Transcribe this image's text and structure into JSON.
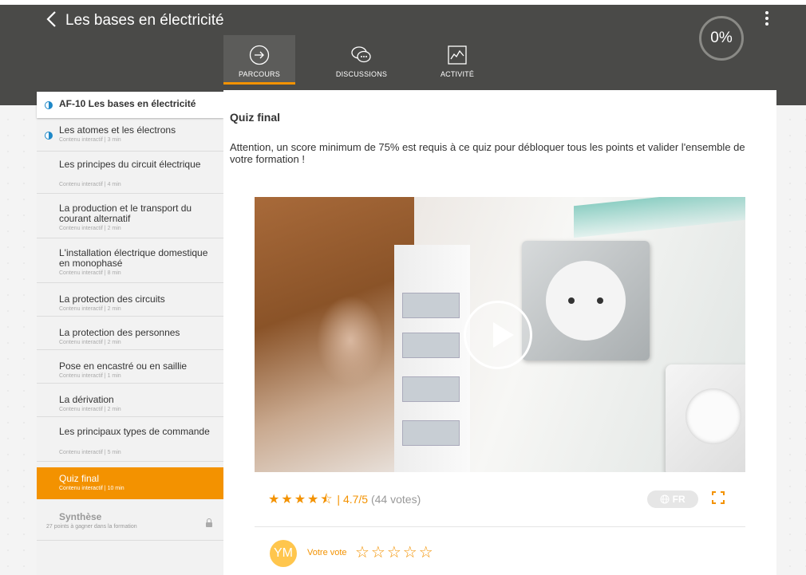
{
  "header": {
    "title": "Les bases en électricité",
    "progress": "0%"
  },
  "tabs": [
    {
      "label": "PARCOURS",
      "icon": "arrow-right-circle-icon",
      "active": true
    },
    {
      "label": "DISCUSSIONS",
      "icon": "chat-bubbles-icon",
      "active": false
    },
    {
      "label": "ACTIVITÉ",
      "icon": "activity-chart-icon",
      "active": false
    }
  ],
  "sidebar": {
    "header": "AF-10 Les bases en électricité",
    "items": [
      {
        "title": "Les atomes et les électrons",
        "sub": "Contenu interactif | 3 min"
      },
      {
        "title": "Les principes du circuit électrique",
        "sub": "Contenu interactif | 4 min"
      },
      {
        "title": "La production et le transport du courant alternatif",
        "sub": "Contenu interactif | 2 min"
      },
      {
        "title": "L'installation électrique domestique en monophasé",
        "sub": "Contenu interactif | 8 min"
      },
      {
        "title": "La protection des circuits",
        "sub": "Contenu interactif | 2 min"
      },
      {
        "title": "La protection des personnes",
        "sub": "Contenu interactif | 2 min"
      },
      {
        "title": "Pose en encastré ou en saillie",
        "sub": "Contenu interactif | 1 min"
      },
      {
        "title": "La dérivation",
        "sub": "Contenu interactif | 2 min"
      },
      {
        "title": "Les principaux types de commande",
        "sub": "Contenu interactif | 5 min"
      },
      {
        "title": "Quiz final",
        "sub": "Contenu interactif | 10 min"
      },
      {
        "title": "Synthèse",
        "sub": "27 points à gagner dans la formation"
      }
    ]
  },
  "main": {
    "title": "Quiz final",
    "description": "Attention, un score minimum de 75% est requis à ce quiz pour débloquer tous les points et valider l'ensemble de votre formation !",
    "rating": {
      "stars": "★★★★⯪",
      "score": "| 4.7/5",
      "votes": "(44 votes)",
      "value": 4.7
    },
    "language": "FR",
    "user_initials": "YM",
    "vote_label": "Votre vote",
    "vote_stars": "☆☆☆☆☆"
  },
  "colors": {
    "accent": "#f39200",
    "header_bg": "#4a4a48",
    "link_blue": "#1e88c8"
  }
}
